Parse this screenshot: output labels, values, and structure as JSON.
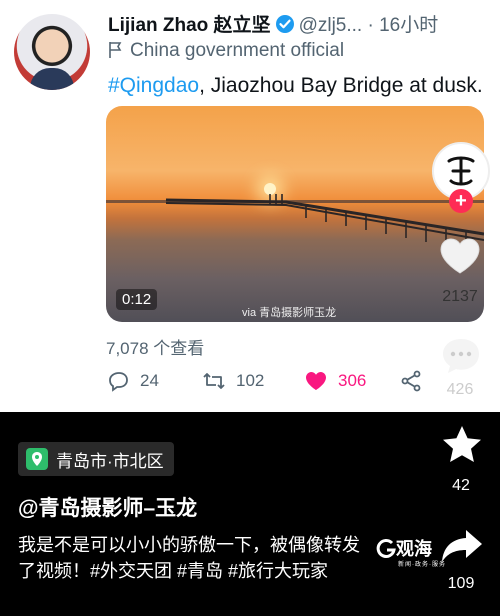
{
  "tweet": {
    "display_name": "Lijian Zhao 赵立坚",
    "handle": "@zlj5...",
    "time": "· 16小时",
    "label": "China government official",
    "hashtag": "#Qingdao",
    "text": ", Jiaozhou Bay Bridge at dusk.",
    "video_time": "0:12",
    "watermark": "via 青岛摄影师玉龙",
    "views": "7,078 个查看",
    "replies": "24",
    "retweets": "102",
    "likes": "306"
  },
  "sidebar": {
    "likes": "2137",
    "comments": "426",
    "favorites": "42",
    "shares": "109"
  },
  "bottom": {
    "location": "青岛市·市北区",
    "author": "@青岛摄影师–玉龙",
    "caption": "我是不是可以小小的骄傲一下，被偶像转发了视频！#外交天团 #青岛 #旅行大玩家",
    "logo": "观海",
    "logo_sub": "新闻·政务·服务"
  },
  "colors": {
    "like_pink": "#f91880",
    "link_blue": "#1d9bf0",
    "verified_blue": "#1d9bf0",
    "location_green": "#2ebd6b",
    "follow_red": "#fe2c55"
  }
}
